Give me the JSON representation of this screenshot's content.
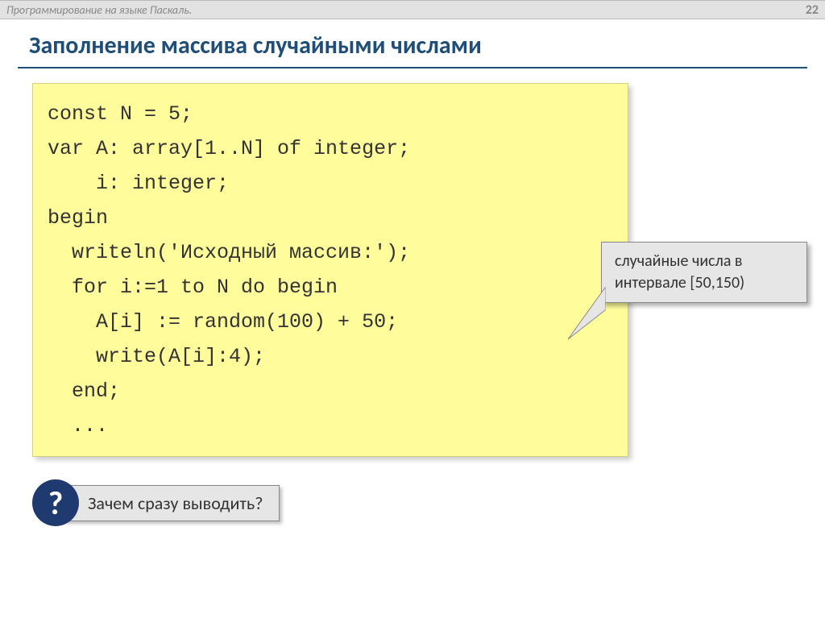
{
  "header": {
    "title": "Программирование на языке Паскаль.",
    "page_number": "22"
  },
  "main_title": "Заполнение массива случайными числами",
  "code": {
    "line1": "const N = 5;",
    "line2": "var A: array[1..N] of integer;",
    "line3": "    i: integer;",
    "line4": "begin",
    "line5": "  writeln('Исходный массив:');",
    "line6": "  for i:=1 to N do begin",
    "line7": "    A[i] := random(100) + 50;",
    "line8": "    write(A[i]:4);",
    "line9": "  end;",
    "line10": "  ..."
  },
  "callout": {
    "line1": "случайные числа в",
    "line2": "интервале [50,150)"
  },
  "question": {
    "badge": "?",
    "text": "Зачем сразу выводить?"
  }
}
